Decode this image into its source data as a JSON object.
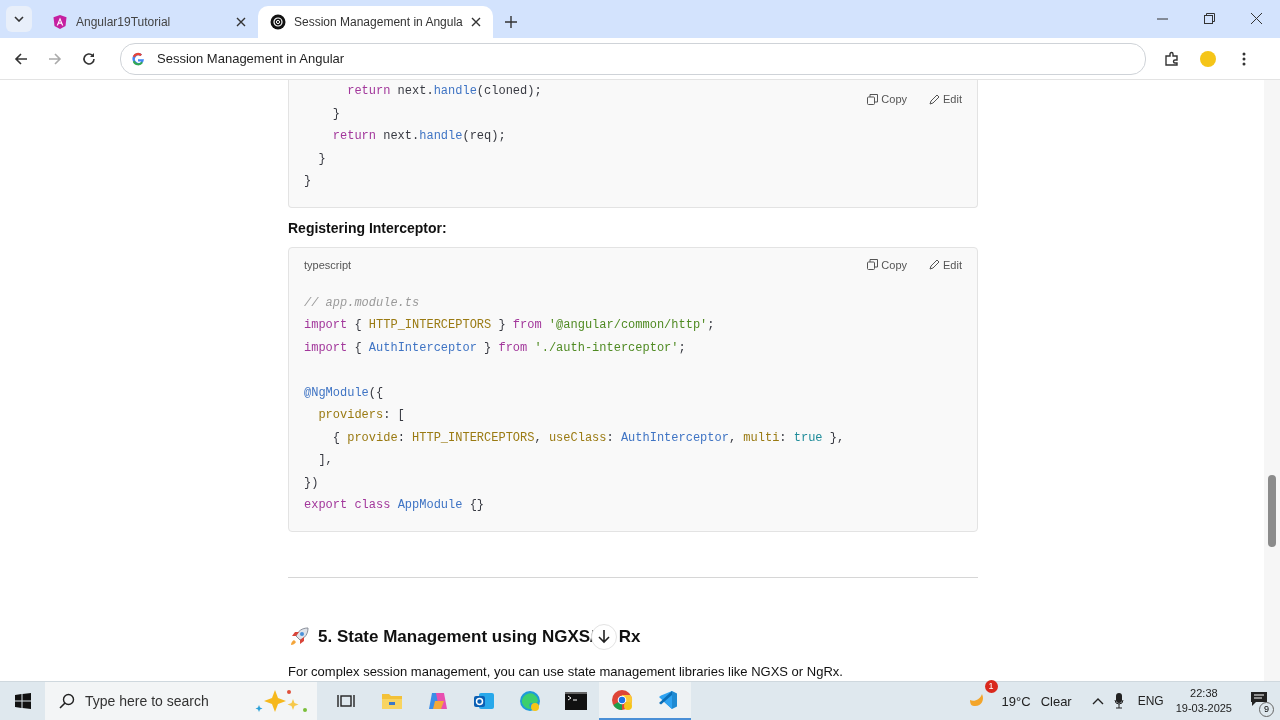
{
  "tabs": [
    {
      "label": "Angular19Tutorial",
      "selected": false
    },
    {
      "label": "Session Management in Angula",
      "selected": true
    }
  ],
  "address_bar": {
    "value": "Session Management in Angular"
  },
  "article": {
    "code_blocks": [
      {
        "actions": [
          "Copy",
          "Edit"
        ],
        "line_groups": [
          [
            [
              {
                "kind": "keyword",
                "text": "      return"
              },
              {
                "kind": "plain",
                "text": " next."
              },
              {
                "kind": "func",
                "text": "handle"
              },
              {
                "kind": "plain",
                "text": "(cloned);"
              }
            ],
            [
              {
                "kind": "plain",
                "text": "    }"
              }
            ],
            [
              {
                "kind": "keyword",
                "text": "    return"
              },
              {
                "kind": "plain",
                "text": " next."
              },
              {
                "kind": "func",
                "text": "handle"
              },
              {
                "kind": "plain",
                "text": "(req);"
              }
            ],
            [
              {
                "kind": "plain",
                "text": "  }"
              }
            ],
            [
              {
                "kind": "plain",
                "text": "}"
              }
            ]
          ]
        ]
      },
      {
        "heading": "Registering Interceptor:",
        "language": "typescript",
        "actions": [
          "Copy",
          "Edit"
        ],
        "line_groups": [
          [
            [
              {
                "kind": "comment",
                "text": "// app.module.ts"
              }
            ],
            [
              {
                "kind": "keyword",
                "text": "import"
              },
              {
                "kind": "plain",
                "text": " { "
              },
              {
                "kind": "const",
                "text": "HTTP_INTERCEPTORS"
              },
              {
                "kind": "plain",
                "text": " } "
              },
              {
                "kind": "keyword",
                "text": "from"
              },
              {
                "kind": "string",
                "text": " '@angular/common/http'"
              },
              {
                "kind": "plain",
                "text": ";"
              }
            ],
            [
              {
                "kind": "keyword",
                "text": "import"
              },
              {
                "kind": "plain",
                "text": " { "
              },
              {
                "kind": "func",
                "text": "AuthInterceptor"
              },
              {
                "kind": "plain",
                "text": " } "
              },
              {
                "kind": "keyword",
                "text": "from"
              },
              {
                "kind": "string",
                "text": " './auth-interceptor'"
              },
              {
                "kind": "plain",
                "text": ";"
              }
            ]
          ],
          [
            [
              {
                "kind": "func",
                "text": "@NgModule"
              },
              {
                "kind": "plain",
                "text": "({"
              }
            ],
            [
              {
                "kind": "const",
                "text": "  providers"
              },
              {
                "kind": "plain",
                "text": ": ["
              }
            ],
            [
              {
                "kind": "plain",
                "text": "    { "
              },
              {
                "kind": "const",
                "text": "provide"
              },
              {
                "kind": "plain",
                "text": ": "
              },
              {
                "kind": "const",
                "text": "HTTP_INTERCEPTORS"
              },
              {
                "kind": "plain",
                "text": ", "
              },
              {
                "kind": "const",
                "text": "useClass"
              },
              {
                "kind": "plain",
                "text": ": "
              },
              {
                "kind": "func",
                "text": "AuthInterceptor"
              },
              {
                "kind": "plain",
                "text": ", "
              },
              {
                "kind": "const",
                "text": "multi"
              },
              {
                "kind": "plain",
                "text": ": "
              },
              {
                "kind": "bool",
                "text": "true"
              },
              {
                "kind": "plain",
                "text": " },"
              }
            ],
            [
              {
                "kind": "plain",
                "text": "  ],"
              }
            ],
            [
              {
                "kind": "plain",
                "text": "})"
              }
            ],
            [
              {
                "kind": "keyword",
                "text": "export"
              },
              {
                "kind": "keyword",
                "text": " class"
              },
              {
                "kind": "func",
                "text": " AppModule"
              },
              {
                "kind": "plain",
                "text": " {}"
              }
            ]
          ]
        ]
      }
    ],
    "section_heading_start": "5. State Management using NGXS/",
    "section_heading_end": "Rx",
    "paragraph": "For complex session management, you can use state management libraries like NGXS or NgRx."
  },
  "taskbar": {
    "search_placeholder": "Type here to search",
    "weather_badge": "1",
    "temperature": "19°C",
    "weather": "Clear",
    "language": "ENG",
    "time": "22:38",
    "date": "19-03-2025",
    "notifications": "9"
  }
}
